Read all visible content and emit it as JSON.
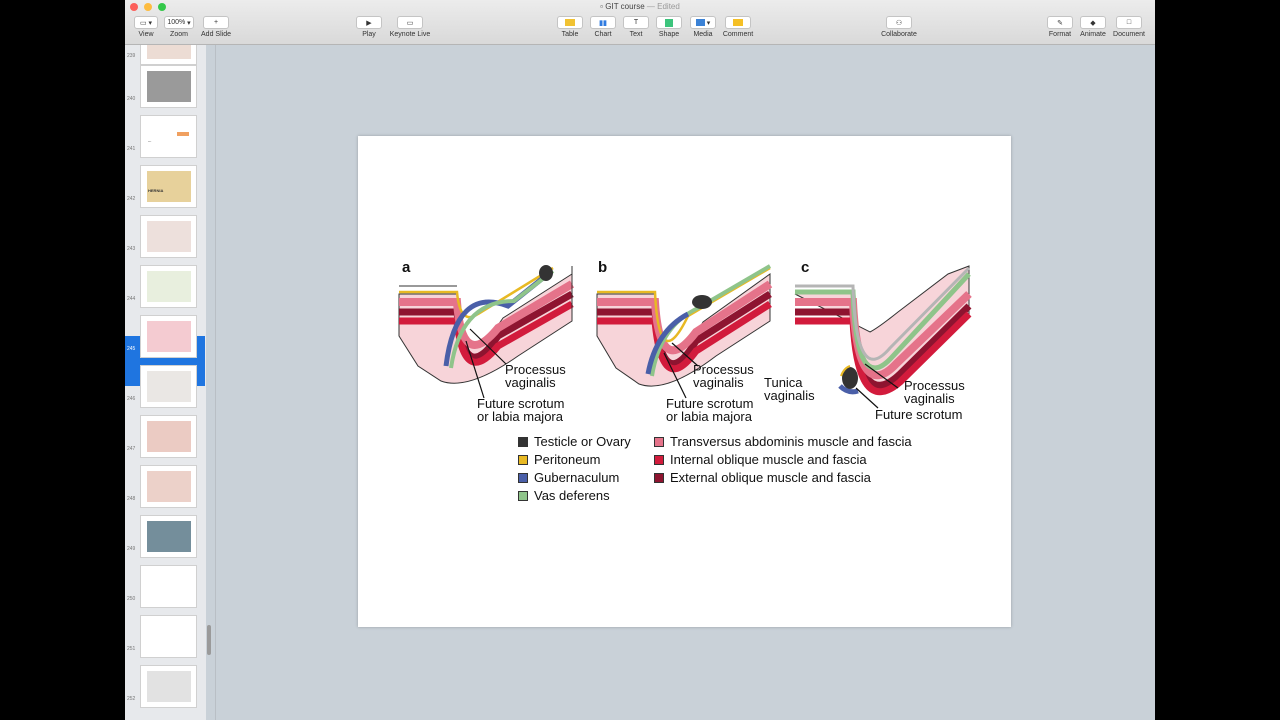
{
  "window": {
    "title": "GIT course",
    "status": "— Edited"
  },
  "toolbar": {
    "view": "View",
    "zoom": "Zoom",
    "zoom_value": "100%",
    "add_slide": "Add Slide",
    "play": "Play",
    "keynote_live": "Keynote Live",
    "table": "Table",
    "chart": "Chart",
    "text": "Text",
    "shape": "Shape",
    "media": "Media",
    "comment": "Comment",
    "collaborate": "Collaborate",
    "format": "Format",
    "animate": "Animate",
    "document": "Document"
  },
  "slides": [
    {
      "num": "239"
    },
    {
      "num": "240"
    },
    {
      "num": "241",
      "text": "..."
    },
    {
      "num": "242",
      "text": "HERNIA"
    },
    {
      "num": "243"
    },
    {
      "num": "244"
    },
    {
      "num": "245"
    },
    {
      "num": "246"
    },
    {
      "num": "247"
    },
    {
      "num": "248"
    },
    {
      "num": "249"
    },
    {
      "num": "250"
    },
    {
      "num": "251"
    },
    {
      "num": "252"
    }
  ],
  "selected_slide": "245",
  "figure": {
    "panels": {
      "a": "a",
      "b": "b",
      "c": "c"
    },
    "ann": {
      "a_proc1": "Processus",
      "a_proc2": "vaginalis",
      "a_fut1": "Future scrotum",
      "a_fut2": "or labia majora",
      "b_proc1": "Processus",
      "b_proc2": "vaginalis",
      "b_fut1": "Future scrotum",
      "b_fut2": "or labia majora",
      "c_tun1": "Tunica",
      "c_tun2": "vaginalis",
      "c_proc1": "Processus",
      "c_proc2": "vaginalis",
      "c_fut": "Future scrotum"
    },
    "legend": [
      {
        "label": "Testicle or Ovary",
        "color": "#333333"
      },
      {
        "label": "Peritoneum",
        "color": "#e8b923"
      },
      {
        "label": "Gubernaculum",
        "color": "#4a5fa8"
      },
      {
        "label": "Vas deferens",
        "color": "#8fc48a"
      },
      {
        "label": "Transversus abdominis muscle and fascia",
        "color": "#e5738a"
      },
      {
        "label": "Internal oblique muscle and fascia",
        "color": "#d21b3c"
      },
      {
        "label": "External oblique muscle and fascia",
        "color": "#8e1430"
      }
    ]
  }
}
